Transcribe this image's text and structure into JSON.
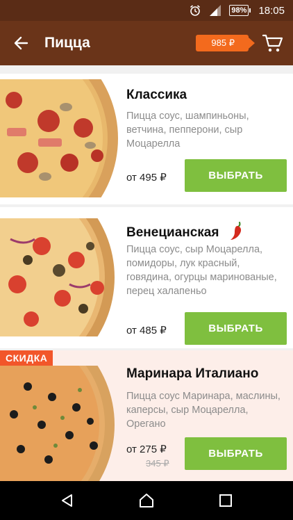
{
  "status_bar": {
    "battery": "98%",
    "time": "18:05"
  },
  "app_bar": {
    "title": "Пицца",
    "cart_total": "985 ₽"
  },
  "products": [
    {
      "name": "Классика",
      "description": "Пицца соус, шампиньоны, ветчина, пепперони, сыр Моцарелла",
      "price": "от 495 ₽",
      "button": "ВЫБРАТЬ"
    },
    {
      "name": "Венецианская",
      "description": "Пицца соус, сыр Моцарелла, помидоры, лук красный, говядина, огурцы маринованые, перец халапеньо",
      "price": "от 485 ₽",
      "button": "ВЫБРАТЬ",
      "spicy": true
    },
    {
      "name": "Маринара Италиано",
      "description": "Пицца соус Маринара, маслины, каперсы, сыр Моцарелла, Орегано",
      "price": "от 275 ₽",
      "old_price": "345 ₽",
      "button": "ВЫБРАТЬ",
      "badge": "СКИДКА"
    }
  ],
  "colors": {
    "status_bar": "#5a2c16",
    "app_bar": "#6a3419",
    "accent_orange": "#f36a1d",
    "button_green": "#7fbf3f",
    "discount_bg": "#fdeee9"
  }
}
